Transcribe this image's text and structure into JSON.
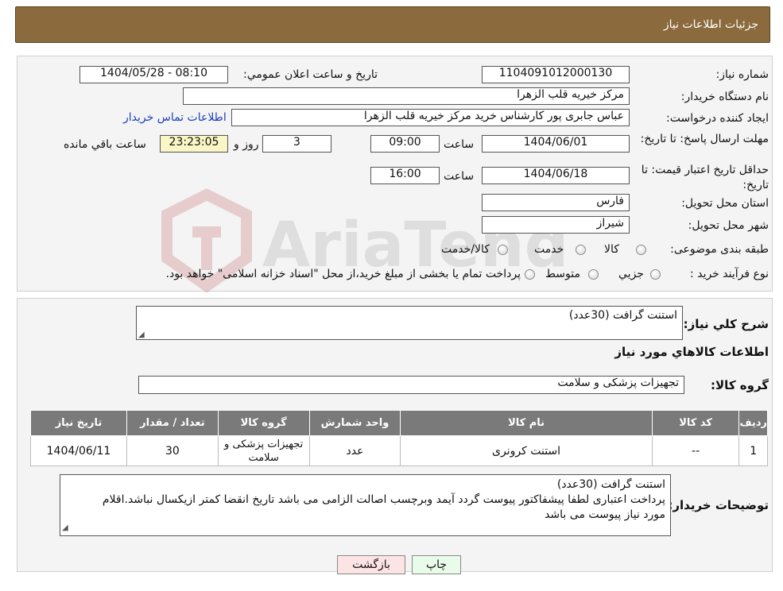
{
  "header": {
    "title": "جزئیات اطلاعات نیاز"
  },
  "fields": {
    "need_number_label": "شماره نياز:",
    "need_number": "1104091012000130",
    "announce_label": "تاريخ و ساعت اعلان عمومي:",
    "announce_value": "1404/05/28 - 08:10",
    "buyer_org_label": "نام دستگاه خريدار:",
    "buyer_org": "مرکز خیریه قلب الزهرا",
    "creator_label": "ايجاد کننده درخواست:",
    "creator": "عباس جابری پور کارشناس خرید مرکز خیریه قلب الزهرا",
    "contact_link": "اطلاعات تماس خريدار",
    "deadline_label": "مهلت ارسال پاسخ: تا تاريخ:",
    "deadline_date": "1404/06/01",
    "time_label": "ساعت",
    "deadline_time": "09:00",
    "days_value": "3",
    "days_label": "روز و",
    "remaining_time": "23:23:05",
    "remaining_label": "ساعت باقي مانده",
    "validity_label": "حداقل تاريخ اعتبار قيمت: تا تاريخ:",
    "validity_date": "1404/06/18",
    "validity_time": "16:00",
    "province_label": "استان محل تحويل:",
    "province": "فارس",
    "city_label": "شهر محل تحويل:",
    "city": "شیراز",
    "category_label": "طبقه بندی موضوعی:",
    "category_options": [
      "کالا",
      "خدمت",
      "کالا/خدمت"
    ],
    "process_label": "نوع فرآيند خريد :",
    "process_options": [
      "جزيي",
      "متوسط"
    ],
    "process_note": "پرداخت تمام يا بخشی از مبلغ خريد،از محل \"اسناد خزانه اسلامی\" خواهد بود."
  },
  "summary": {
    "label": "شرح کلي نياز:",
    "text": "استنت گرافت    (30عدد)",
    "items_heading": "اطلاعات کالاهاي مورد نياز",
    "group_label": "گروه کالا:",
    "group_value": "تجهیزات پزشکی و سلامت"
  },
  "table": {
    "headers": [
      "رديف",
      "کد کالا",
      "نام کالا",
      "واحد شمارش",
      "گروه کالا",
      "تعداد / مقدار",
      "تاريخ نياز"
    ],
    "rows": [
      [
        "1",
        "--",
        "استنت کرونری",
        "عدد",
        "تجهیزات پزشکی و سلامت",
        "30",
        "1404/06/11"
      ]
    ]
  },
  "buyer_notes": {
    "label": "توضيحات خريدار:",
    "line1": "استنت گرافت    (30عدد)",
    "line2": "پرداخت اعتباری لطفا پیشفاکتور پیوست گردد آیمد وبرچسب اصالت الزامی می باشد تاریخ انقضا کمتر ازیکسال نباشد.اقلام",
    "line3": "مورد نیاز پیوست می باشد"
  },
  "buttons": {
    "print": "چاپ",
    "back": "بازگشت"
  },
  "watermark": {
    "text": "AriaTender.neT"
  },
  "colors": {
    "header_bg": "#8b6a3e",
    "link": "#1a3fbf",
    "table_header": "#7a7a7a",
    "highlight": "#fbf6c5"
  }
}
